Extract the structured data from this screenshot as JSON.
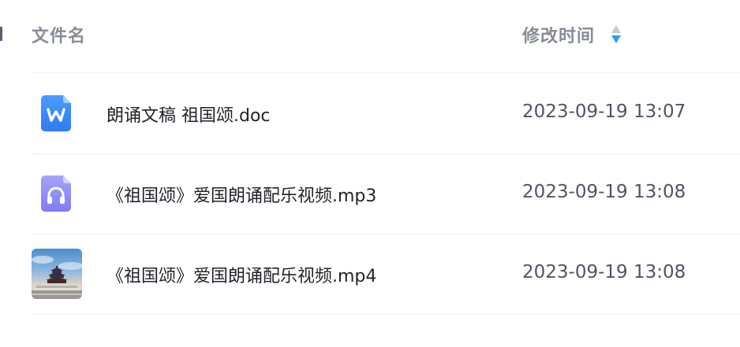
{
  "header": {
    "name_label": "文件名",
    "time_label": "修改时间"
  },
  "rows": [
    {
      "name": "朗诵文稿 祖国颂.doc",
      "time": "2023-09-19 13:07",
      "icon": "word-doc-icon"
    },
    {
      "name": "《祖国颂》爱国朗诵配乐视频.mp3",
      "time": "2023-09-19 13:08",
      "icon": "audio-file-icon"
    },
    {
      "name": "《祖国颂》爱国朗诵配乐视频.mp4",
      "time": "2023-09-19 13:08",
      "icon": "video-thumbnail-icon"
    }
  ],
  "colors": {
    "word_blue": "#3d8bf7",
    "audio_purple": "#8e8cf6",
    "sort_active": "#2e9bf0",
    "sort_inactive": "#c4c8d0"
  }
}
